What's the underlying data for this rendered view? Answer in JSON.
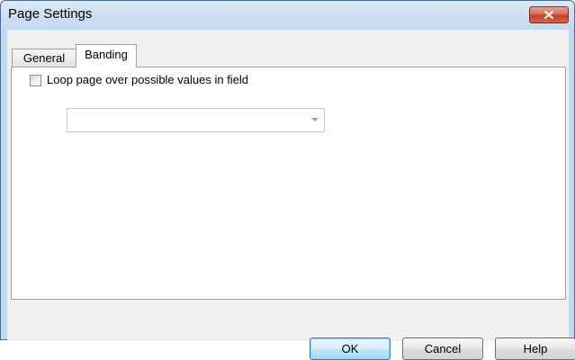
{
  "window": {
    "title": "Page Settings",
    "close_icon": "close-x-icon"
  },
  "tabs": [
    {
      "label": "General",
      "selected": false
    },
    {
      "label": "Banding",
      "selected": true
    }
  ],
  "banding": {
    "loop_checkbox_label": "Loop page over possible values in field",
    "loop_checked": false,
    "field_combo_value": "",
    "combo_arrow_icon": "chevron-down-icon"
  },
  "buttons": {
    "ok_label": "OK",
    "cancel_label": "Cancel",
    "help_label": "Help"
  },
  "colors": {
    "titlebar": "#c3d7ee",
    "close_button": "#c3402a",
    "client_bg": "#f0f0f0",
    "default_button_border": "#3c7fb1"
  }
}
